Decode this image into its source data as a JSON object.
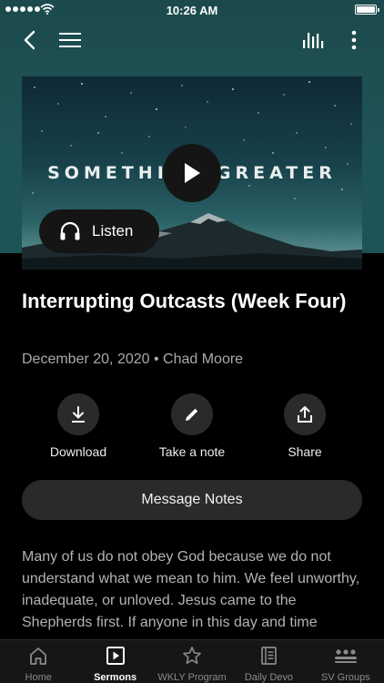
{
  "status_bar": {
    "time": "10:26 AM"
  },
  "nav": {
    "back_icon": "chevron-left-icon",
    "menu_icon": "hamburger-icon",
    "audio_icon": "audio-bars-icon",
    "more_icon": "more-vertical-icon"
  },
  "hero": {
    "artwork_text": "SOMETHING GREATER",
    "listen_label": "Listen"
  },
  "sermon": {
    "title": "Interrupting Outcasts (Week Four)",
    "meta": "December 20, 2020 • Chad Moore"
  },
  "actions": [
    {
      "label": "Download",
      "icon": "download-icon"
    },
    {
      "label": "Take a note",
      "icon": "pencil-icon"
    },
    {
      "label": "Share",
      "icon": "share-icon"
    }
  ],
  "message_notes_label": "Message Notes",
  "description": "Many of us do not obey God because we do not understand what we mean to him. We feel unworthy, inadequate, or unloved. Jesus came to the Shepherds first. If anyone in this day and time",
  "tabs": [
    {
      "label": "Home",
      "icon": "home-icon",
      "active": false
    },
    {
      "label": "Sermons",
      "icon": "play-square-icon",
      "active": true
    },
    {
      "label": "WKLY Program",
      "icon": "star-icon",
      "active": false
    },
    {
      "label": "Daily Devo",
      "icon": "book-icon",
      "active": false
    },
    {
      "label": "SV Groups",
      "icon": "groups-icon",
      "active": false
    }
  ]
}
